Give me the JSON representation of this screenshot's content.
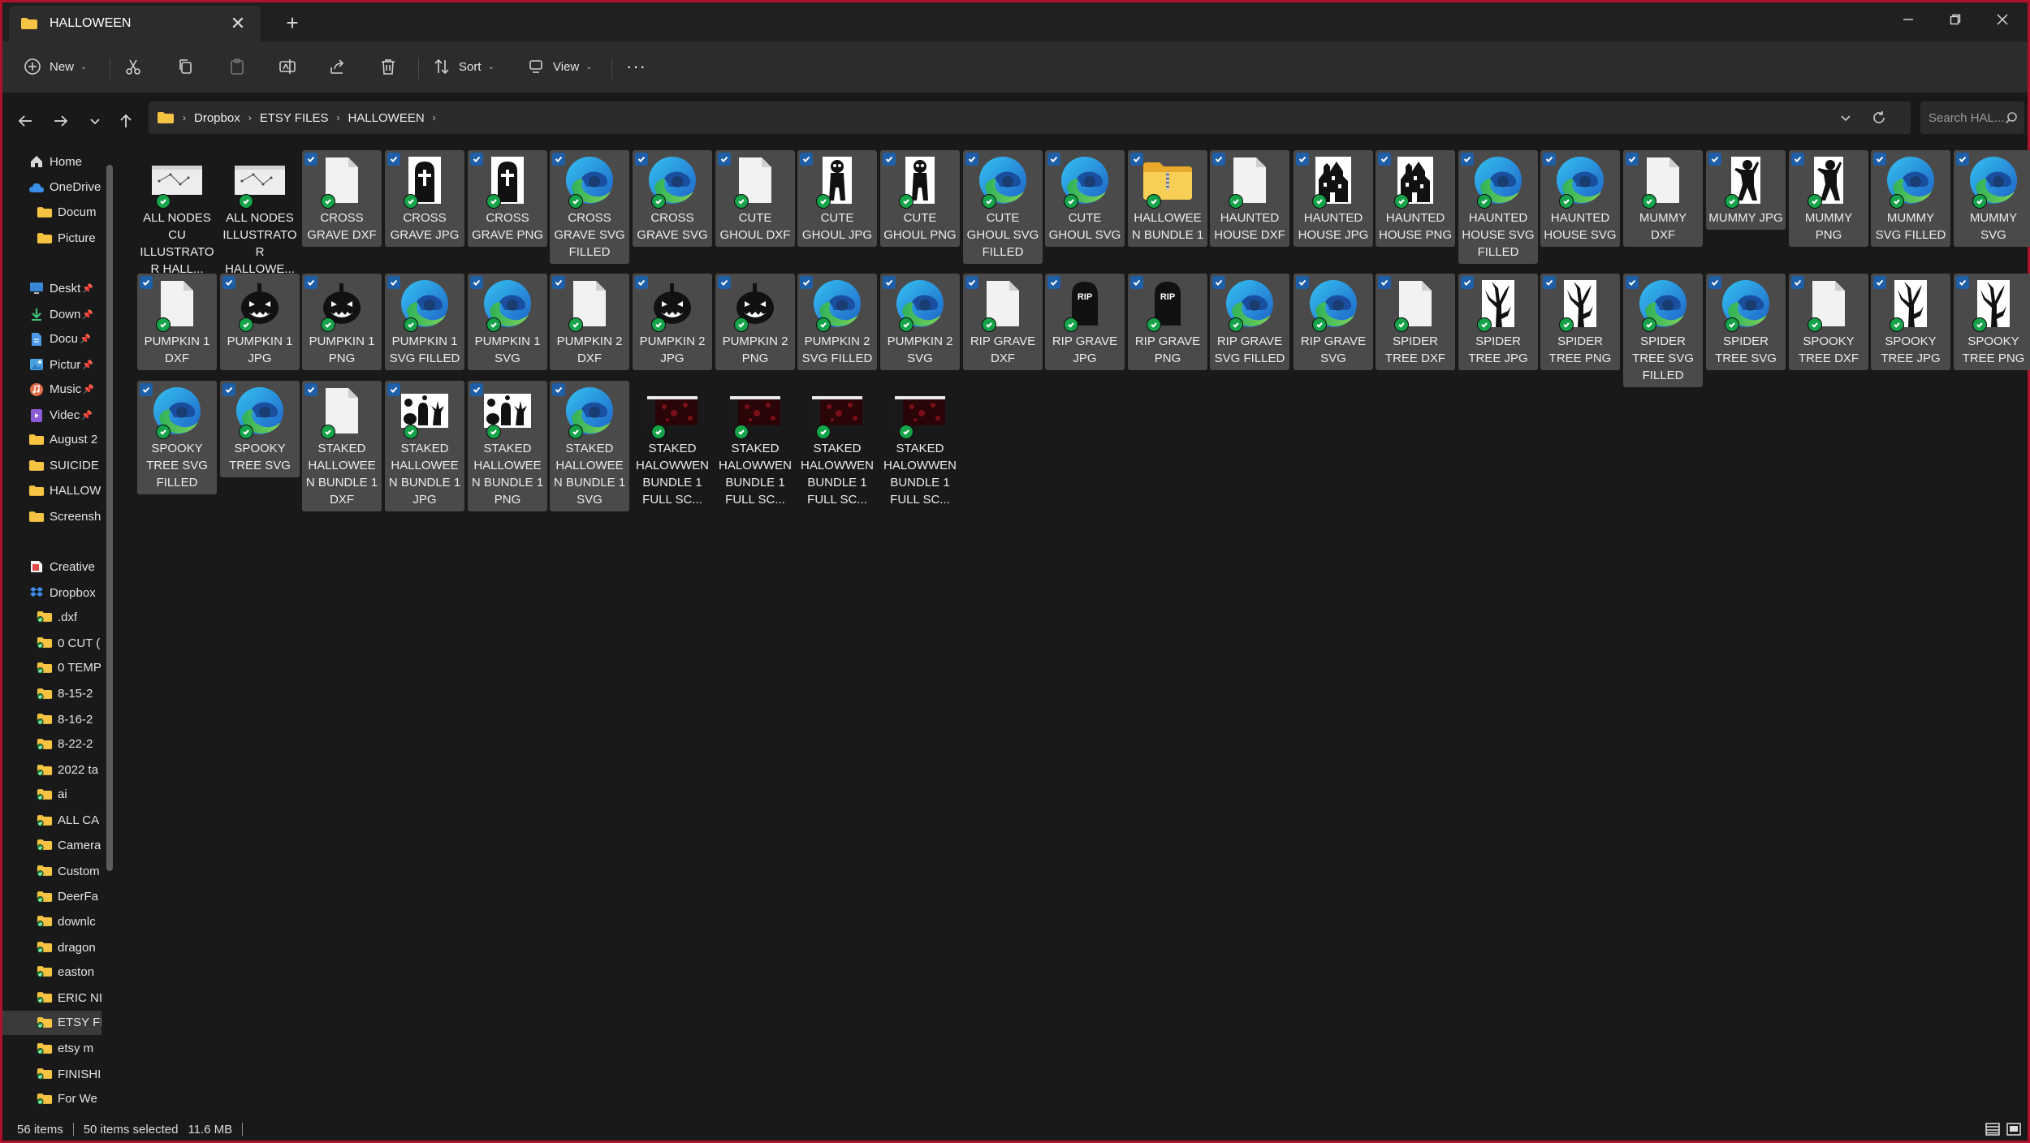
{
  "window": {
    "tab_title": "HALLOWEEN",
    "tab_close": "✕",
    "new_tab": "+",
    "colors": {
      "border": "#b0122a",
      "selected_bg": "#4a4a4a",
      "checkbox": "#1f5fa8",
      "sync": "#16a34a",
      "folder": "#f6c343"
    }
  },
  "toolbar": {
    "new_label": "New",
    "sort_label": "Sort",
    "view_label": "View",
    "more_label": "···",
    "icons": [
      "new-icon",
      "cut-icon",
      "copy-icon",
      "paste-icon",
      "rename-icon",
      "share-icon",
      "delete-icon",
      "sort-icon",
      "view-icon",
      "more-icon"
    ]
  },
  "address": {
    "crumbs": [
      "Dropbox",
      "ETSY FILES",
      "HALLOWEEN"
    ],
    "search_placeholder": "Search HAL..."
  },
  "nav": {
    "items": [
      {
        "label": "Home",
        "icon": "home-icon",
        "pinned": false,
        "selected": false
      },
      {
        "label": "OneDrive",
        "icon": "cloud-icon",
        "pinned": false,
        "selected": false
      },
      {
        "label": "Docum",
        "icon": "folder-icon",
        "pinned": false,
        "selected": false
      },
      {
        "label": "Picture",
        "icon": "folder-icon",
        "pinned": false,
        "selected": false
      },
      {
        "label": "Deskt",
        "icon": "desktop-icon",
        "pinned": true,
        "selected": false
      },
      {
        "label": "Down",
        "icon": "download-icon",
        "pinned": true,
        "selected": false
      },
      {
        "label": "Docu",
        "icon": "document-icon",
        "pinned": true,
        "selected": false
      },
      {
        "label": "Pictur",
        "icon": "pictures-icon",
        "pinned": true,
        "selected": false
      },
      {
        "label": "Music",
        "icon": "music-icon",
        "pinned": true,
        "selected": false
      },
      {
        "label": "Videc",
        "icon": "video-icon",
        "pinned": true,
        "selected": false
      },
      {
        "label": "August 2",
        "icon": "folder-icon",
        "pinned": false,
        "selected": false
      },
      {
        "label": "SUICIDE",
        "icon": "folder-icon",
        "pinned": false,
        "selected": false
      },
      {
        "label": "HALLOW",
        "icon": "folder-icon",
        "pinned": false,
        "selected": false
      },
      {
        "label": "Screensh",
        "icon": "folder-icon",
        "pinned": false,
        "selected": false
      },
      {
        "label": "Creative",
        "icon": "creative-cloud-icon",
        "pinned": false,
        "selected": false
      },
      {
        "label": "Dropbox",
        "icon": "dropbox-icon",
        "pinned": false,
        "selected": false
      },
      {
        "label": ".dxf",
        "icon": "folder-sync-icon",
        "pinned": false,
        "selected": false
      },
      {
        "label": "0 CUT (",
        "icon": "folder-sync-icon",
        "pinned": false,
        "selected": false
      },
      {
        "label": "0 TEMP",
        "icon": "folder-sync-icon",
        "pinned": false,
        "selected": false
      },
      {
        "label": "8-15-2",
        "icon": "folder-sync-icon",
        "pinned": false,
        "selected": false
      },
      {
        "label": "8-16-2",
        "icon": "folder-sync-icon",
        "pinned": false,
        "selected": false
      },
      {
        "label": "8-22-2",
        "icon": "folder-sync-icon",
        "pinned": false,
        "selected": false
      },
      {
        "label": "2022 ta",
        "icon": "folder-sync-icon",
        "pinned": false,
        "selected": false
      },
      {
        "label": "ai",
        "icon": "folder-sync-icon",
        "pinned": false,
        "selected": false
      },
      {
        "label": "ALL CA",
        "icon": "folder-sync-icon",
        "pinned": false,
        "selected": false
      },
      {
        "label": "Camera",
        "icon": "folder-sync-icon",
        "pinned": false,
        "selected": false
      },
      {
        "label": "Custom",
        "icon": "folder-sync-icon",
        "pinned": false,
        "selected": false
      },
      {
        "label": "DeerFa",
        "icon": "folder-sync-icon",
        "pinned": false,
        "selected": false
      },
      {
        "label": "downlc",
        "icon": "folder-sync-icon",
        "pinned": false,
        "selected": false
      },
      {
        "label": "dragon",
        "icon": "folder-sync-icon",
        "pinned": false,
        "selected": false
      },
      {
        "label": "easton",
        "icon": "folder-sync-icon",
        "pinned": false,
        "selected": false
      },
      {
        "label": "ERIC NI",
        "icon": "folder-sync-icon",
        "pinned": false,
        "selected": false
      },
      {
        "label": "ETSY FI",
        "icon": "folder-sync-icon",
        "pinned": false,
        "selected": true
      },
      {
        "label": "etsy m",
        "icon": "folder-sync-icon",
        "pinned": false,
        "selected": false
      },
      {
        "label": "FINISHI",
        "icon": "folder-sync-icon",
        "pinned": false,
        "selected": false
      },
      {
        "label": "For We",
        "icon": "folder-sync-icon",
        "pinned": false,
        "selected": false
      }
    ]
  },
  "files": [
    {
      "name": "ALL NODES CU ILLUSTRATOR HALL...",
      "icon": "screenshot-thumbnail-icon",
      "selected": false
    },
    {
      "name": "ALL NODES ILLUSTRATOR HALLOWE...",
      "icon": "screenshot-thumbnail-icon",
      "selected": false
    },
    {
      "name": "CROSS GRAVE DXF",
      "icon": "blank-file-icon",
      "selected": true
    },
    {
      "name": "CROSS GRAVE JPG",
      "icon": "grave-cross-silhouette-icon",
      "selected": true
    },
    {
      "name": "CROSS GRAVE PNG",
      "icon": "grave-cross-silhouette-icon",
      "selected": true
    },
    {
      "name": "CROSS GRAVE SVG FILLED",
      "icon": "edge-browser-icon",
      "selected": true
    },
    {
      "name": "CROSS GRAVE SVG",
      "icon": "edge-browser-icon",
      "selected": true
    },
    {
      "name": "CUTE GHOUL DXF",
      "icon": "blank-file-icon",
      "selected": true
    },
    {
      "name": "CUTE GHOUL JPG",
      "icon": "ghoul-silhouette-icon",
      "selected": true
    },
    {
      "name": "CUTE GHOUL PNG",
      "icon": "ghoul-silhouette-icon",
      "selected": true
    },
    {
      "name": "CUTE GHOUL SVG FILLED",
      "icon": "edge-browser-icon",
      "selected": true
    },
    {
      "name": "CUTE GHOUL SVG",
      "icon": "edge-browser-icon",
      "selected": true
    },
    {
      "name": "HALLOWEEN BUNDLE 1",
      "icon": "zip-folder-icon",
      "selected": true
    },
    {
      "name": "HAUNTED HOUSE DXF",
      "icon": "blank-file-icon",
      "selected": true
    },
    {
      "name": "HAUNTED HOUSE JPG",
      "icon": "haunted-house-silhouette-icon",
      "selected": true
    },
    {
      "name": "HAUNTED HOUSE PNG",
      "icon": "haunted-house-silhouette-icon",
      "selected": true
    },
    {
      "name": "HAUNTED HOUSE SVG FILLED",
      "icon": "edge-browser-icon",
      "selected": true
    },
    {
      "name": "HAUNTED HOUSE SVG",
      "icon": "edge-browser-icon",
      "selected": true
    },
    {
      "name": "MUMMY DXF",
      "icon": "blank-file-icon",
      "selected": true
    },
    {
      "name": "MUMMY JPG",
      "icon": "mummy-silhouette-icon",
      "selected": true
    },
    {
      "name": "MUMMY PNG",
      "icon": "mummy-silhouette-icon",
      "selected": true
    },
    {
      "name": "MUMMY SVG FILLED",
      "icon": "edge-browser-icon",
      "selected": true
    },
    {
      "name": "MUMMY SVG",
      "icon": "edge-browser-icon",
      "selected": true
    },
    {
      "name": "PUMPKIN 1 DXF",
      "icon": "blank-file-icon",
      "selected": true
    },
    {
      "name": "PUMPKIN 1 JPG",
      "icon": "pumpkin-silhouette-icon",
      "selected": true
    },
    {
      "name": "PUMPKIN 1 PNG",
      "icon": "pumpkin-silhouette-icon",
      "selected": true
    },
    {
      "name": "PUMPKIN 1 SVG FILLED",
      "icon": "edge-browser-icon",
      "selected": true
    },
    {
      "name": "PUMPKIN 1 SVG",
      "icon": "edge-browser-icon",
      "selected": true
    },
    {
      "name": "PUMPKIN 2 DXF",
      "icon": "blank-file-icon",
      "selected": true
    },
    {
      "name": "PUMPKIN 2 JPG",
      "icon": "pumpkin-silhouette-icon",
      "selected": true
    },
    {
      "name": "PUMPKIN 2 PNG",
      "icon": "pumpkin-silhouette-icon",
      "selected": true
    },
    {
      "name": "PUMPKIN 2 SVG FILLED",
      "icon": "edge-browser-icon",
      "selected": true
    },
    {
      "name": "PUMPKIN 2 SVG",
      "icon": "edge-browser-icon",
      "selected": true
    },
    {
      "name": "RIP GRAVE DXF",
      "icon": "blank-file-icon",
      "selected": true
    },
    {
      "name": "RIP GRAVE JPG",
      "icon": "rip-grave-silhouette-icon",
      "selected": true
    },
    {
      "name": "RIP GRAVE PNG",
      "icon": "rip-grave-silhouette-icon",
      "selected": true
    },
    {
      "name": "RIP GRAVE SVG FILLED",
      "icon": "edge-browser-icon",
      "selected": true
    },
    {
      "name": "RIP GRAVE SVG",
      "icon": "edge-browser-icon",
      "selected": true
    },
    {
      "name": "SPIDER TREE DXF",
      "icon": "blank-file-icon",
      "selected": true
    },
    {
      "name": "SPIDER TREE JPG",
      "icon": "tree-silhouette-icon",
      "selected": true
    },
    {
      "name": "SPIDER TREE PNG",
      "icon": "tree-silhouette-icon",
      "selected": true
    },
    {
      "name": "SPIDER TREE SVG FILLED",
      "icon": "edge-browser-icon",
      "selected": true
    },
    {
      "name": "SPIDER TREE SVG",
      "icon": "edge-browser-icon",
      "selected": true
    },
    {
      "name": "SPOOKY TREE DXF",
      "icon": "blank-file-icon",
      "selected": true
    },
    {
      "name": "SPOOKY TREE JPG",
      "icon": "tree-silhouette-icon",
      "selected": true
    },
    {
      "name": "SPOOKY TREE PNG",
      "icon": "tree-silhouette-icon",
      "selected": true
    },
    {
      "name": "SPOOKY TREE SVG FILLED",
      "icon": "edge-browser-icon",
      "selected": true
    },
    {
      "name": "SPOOKY TREE SVG",
      "icon": "edge-browser-icon",
      "selected": true
    },
    {
      "name": "STAKED HALLOWEEN BUNDLE 1 DXF",
      "icon": "blank-file-icon",
      "selected": true
    },
    {
      "name": "STAKED HALLOWEEN BUNDLE 1 JPG",
      "icon": "bundle-silhouettes-icon",
      "selected": true
    },
    {
      "name": "STAKED HALLOWEEN BUNDLE 1 PNG",
      "icon": "bundle-silhouettes-icon",
      "selected": true
    },
    {
      "name": "STAKED HALLOWEEN BUNDLE 1 SVG",
      "icon": "edge-browser-icon",
      "selected": true
    },
    {
      "name": "STAKED HALOWWEN BUNDLE 1 FULL SC...",
      "icon": "screenshot-thumbnail-icon",
      "selected": false
    },
    {
      "name": "STAKED HALOWWEN BUNDLE 1 FULL SC...",
      "icon": "screenshot-thumbnail-icon",
      "selected": false
    },
    {
      "name": "STAKED HALOWWEN BUNDLE 1 FULL SC...",
      "icon": "screenshot-thumbnail-icon",
      "selected": false
    },
    {
      "name": "STAKED HALOWWEN BUNDLE 1 FULL SC...",
      "icon": "screenshot-thumbnail-icon",
      "selected": false
    }
  ],
  "status": {
    "item_count": "56 items",
    "selection": "50 items selected",
    "size": "11.6 MB"
  }
}
